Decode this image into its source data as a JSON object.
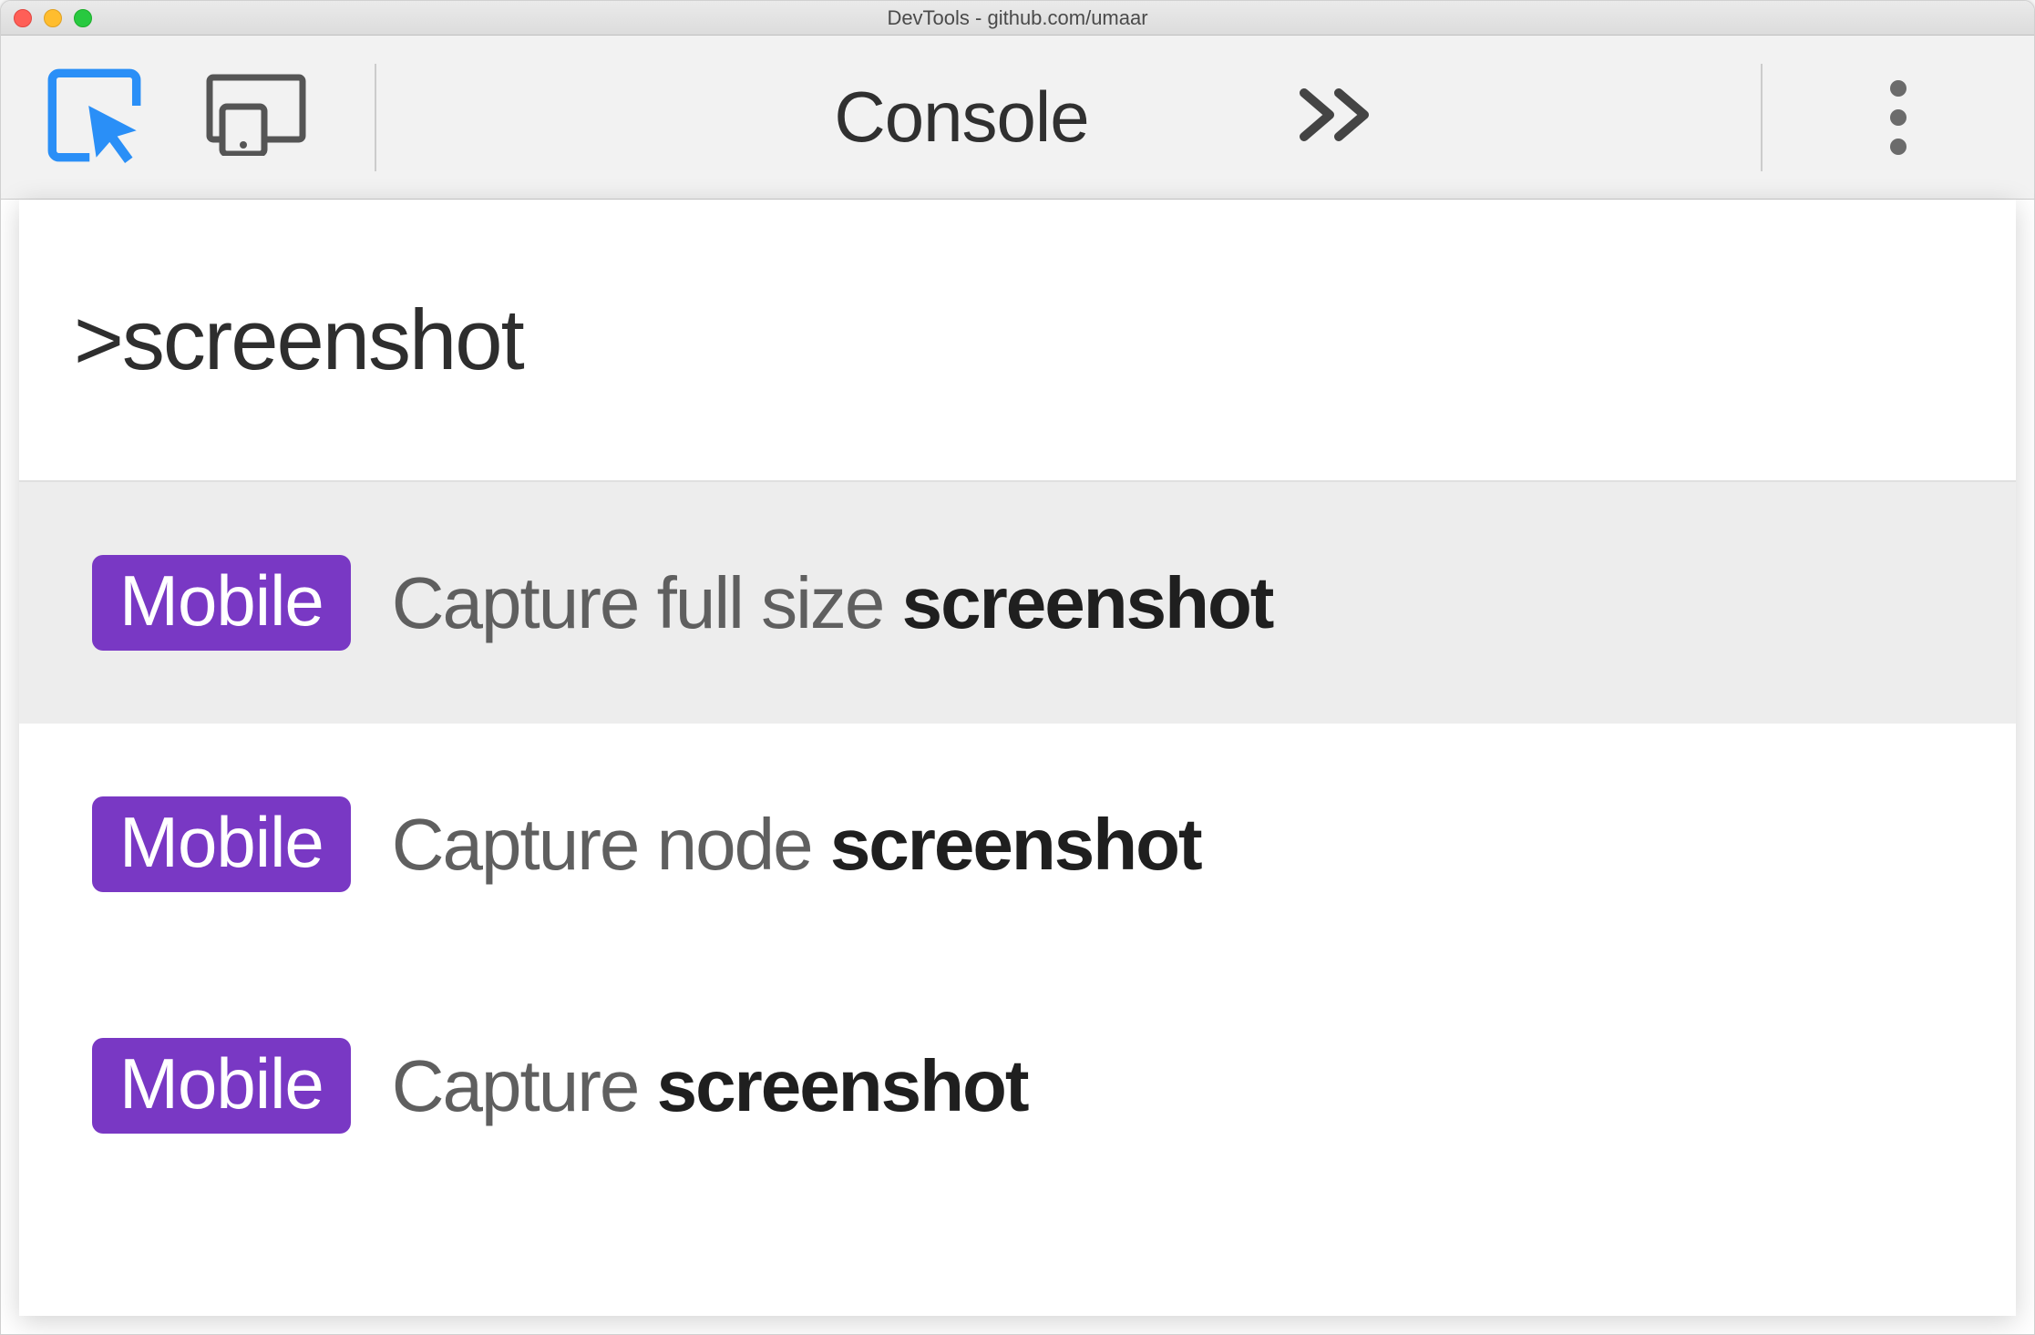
{
  "window": {
    "title": "DevTools - github.com/umaar"
  },
  "toolbar": {
    "panel_label": "Console"
  },
  "command_menu": {
    "input_value": ">screenshot",
    "badge_label": "Mobile",
    "results": [
      {
        "prefix": "Capture full size ",
        "match": "screenshot",
        "selected": true
      },
      {
        "prefix": "Capture node ",
        "match": "screenshot",
        "selected": false
      },
      {
        "prefix": "Capture ",
        "match": "screenshot",
        "selected": false
      }
    ]
  }
}
